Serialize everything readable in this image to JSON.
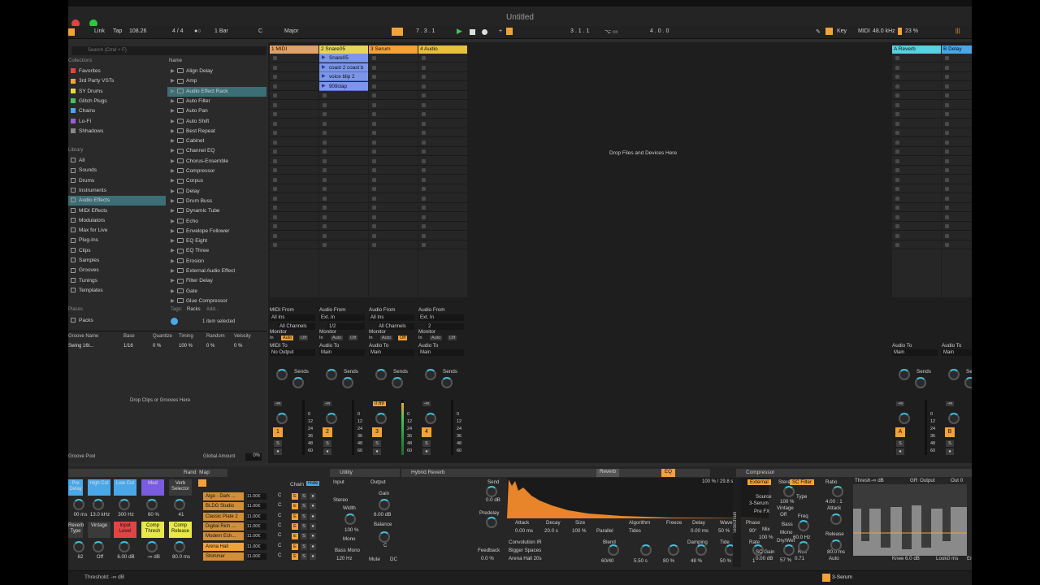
{
  "window": {
    "title": "Untitled"
  },
  "control_bar": {
    "link": "Link",
    "tap": "Tap",
    "tempo": "108.26",
    "signature": "4 / 4",
    "quant": "1 Bar",
    "key": "C",
    "scale": "Major",
    "position": "7 .  3 .  1",
    "loop_start": "3 .  1 .  1",
    "loop_len": "4 .  0 .  0",
    "key_map": "Key",
    "midi": "MIDI",
    "sample_rate": "48.0 kHz",
    "cpu": "23 %"
  },
  "browser": {
    "search_placeholder": "Search (Cmd + F)",
    "collections_header": "Collections",
    "collections": [
      {
        "label": "Favorites",
        "color": "#e04545"
      },
      {
        "label": "3rd Party VSTs",
        "color": "#f2a23a"
      },
      {
        "label": "SY Drums",
        "color": "#e8d83a"
      },
      {
        "label": "Glitch Plugs",
        "color": "#46c25a"
      },
      {
        "label": "Chains",
        "color": "#4aa7e8"
      },
      {
        "label": "Lo-FI",
        "color": "#9a5ce0"
      },
      {
        "label": "Shhadows",
        "color": "#888888"
      }
    ],
    "library_header": "Library",
    "library": [
      "All",
      "Sounds",
      "Drums",
      "Instruments",
      "Audio Effects",
      "MIDI Effects",
      "Modulators",
      "Max for Live",
      "Plug-Ins",
      "Clips",
      "Samples",
      "Grooves",
      "Tunings",
      "Templates"
    ],
    "places_header": "Places",
    "places": [
      "Packs"
    ],
    "name_header": "Name",
    "files": [
      "Align Delay",
      "Amp",
      "Audio Effect Rack",
      "Auto Filter",
      "Auto Pan",
      "Auto Shift",
      "Best Repeat",
      "Cabinet",
      "Channel EQ",
      "Chorus-Ensemble",
      "Compressor",
      "Corpus",
      "Delay",
      "Drum Buss",
      "Dynamic Tube",
      "Echo",
      "Envelope Follower",
      "EQ Eight",
      "EQ Three",
      "Erosion",
      "External Audio Effect",
      "Filter Delay",
      "Gate",
      "Glue Compressor"
    ],
    "tags_label": "Tags:",
    "tag_racks": "Racks",
    "tag_add": "Add...",
    "selected": "1 item selected"
  },
  "groove": {
    "headers": [
      "Groove Name",
      "Base",
      "Quantize",
      "Timing",
      "Random",
      "Velocity"
    ],
    "row": [
      "Swing 16t...",
      "1/16",
      "0 %",
      "100 %",
      "0 %",
      "0 %"
    ],
    "drop_text": "Drop Clips or Grooves Here",
    "pool": "Groove Pool",
    "global_label": "Global Amount",
    "global_value": "0%"
  },
  "session": {
    "tracks": [
      {
        "name": "1 MIDI",
        "color": "#e0a16a",
        "clips": [],
        "num": "1"
      },
      {
        "name": "2 Snare05",
        "color": "#e8d45a",
        "clips": [
          "Snare05",
          "coast 2 coast b",
          "voice blip 2",
          "909clap"
        ],
        "num": "2"
      },
      {
        "name": "3 Serum",
        "color": "#f2a23a",
        "clips": [],
        "num": "3"
      },
      {
        "name": "4 Audio",
        "color": "#e8c040",
        "clips": [],
        "num": "4"
      }
    ],
    "returns": [
      {
        "name": "A Reverb",
        "color": "#5ad0e0",
        "num": "A"
      },
      {
        "name": "B Delay",
        "color": "#4aa7e8",
        "num": "B"
      }
    ],
    "master": {
      "name": "Main",
      "color": "#e8e84a"
    },
    "drop_text": "Drop Files and Devices Here",
    "scene_numbers": [
      "1",
      "2",
      "3",
      "4",
      "5",
      "6",
      "7",
      "8",
      "9",
      "10",
      "11",
      "12",
      "13",
      "14",
      "15",
      "16",
      "17",
      "18",
      "19",
      "20",
      "21"
    ],
    "io": {
      "midi_from": "MIDI From",
      "all_ins": "All Ins",
      "all_channels": "All Channels",
      "monitor": "Monitor",
      "in": "In",
      "auto": "Auto",
      "off": "Off",
      "midi_to": "MIDI To",
      "no_output": "No Output",
      "audio_from": "Audio From",
      "ext_in": "Ext. In",
      "ch12": "1/2",
      "ch2": "2",
      "audio_to": "Audio To",
      "main": "Main",
      "sends": "Sends",
      "cue_out": "Cue Out",
      "main_out": "Main Out",
      "post": "Post",
      "solo": "Solo"
    },
    "serum_meter": "0.69",
    "neg_inf": "-∞",
    "db_scale": [
      "0",
      "12",
      "24",
      "36",
      "48",
      "60"
    ]
  },
  "devices": {
    "rand": "Rand",
    "map": "Map",
    "macros_top": [
      "Pre Delay",
      "High Cut",
      "Low Cut",
      "Mod",
      "Verb Selector"
    ],
    "macro_vals_top": [
      "00 ms",
      "13.0 kHz",
      "300 Hz",
      "60 %",
      "41"
    ],
    "macros_bottom": [
      "Reverb Type",
      "Vintage",
      "Input Level",
      "Comp Thresh",
      "Comp Release"
    ],
    "macro_vals_bottom": [
      "82",
      "Off",
      "6.00 dB",
      "-∞ dB",
      "80.0 ms"
    ],
    "chain_label": "Chain",
    "hide": "Hide",
    "chains": [
      "Algo - Dark ...",
      "BLDG Studio",
      "Classic Plate 2",
      "Digital Rich ...",
      "Modern Ech...",
      "Arena Hall",
      "Shimmer"
    ],
    "chain_vol": "11.00€",
    "utility": {
      "name": "Utility",
      "input": "Input",
      "output": "Output",
      "stereo": "Stereo",
      "width": "Width",
      "width_val": "100 %",
      "mono": "Mono",
      "bass_mono": "Bass Mono",
      "bass_freq": "120 Hz",
      "gain": "Gain",
      "gain_val": "6.00 dB",
      "balance": "Balance",
      "balance_val": "C",
      "mute": "Mute",
      "dc": "DC"
    },
    "reverb": {
      "name": "Hybrid Reverb",
      "tab1": "Reverb",
      "tab2": "EQ",
      "send": "Send",
      "send_val": "0.0 dB",
      "predelay": "Predelay",
      "feedback": "Feedback",
      "feedback_val": "0.0 %",
      "time": "100 % / 29.8 s",
      "attack": "Attack",
      "decay": "Decay",
      "size": "Size",
      "attack_val": "0.00 ms",
      "decay_val": "20.0 s",
      "size_val": "100 %",
      "algorithm": "Algorithm",
      "algo_val": "Tides",
      "freeze": "Freeze",
      "delay": "Delay",
      "delay_val": "0.00 ms",
      "wave": "Wave",
      "wave_val": "50 %",
      "phase": "Phase",
      "phase_val": "90°",
      "parallel": "Parallel",
      "conv_ir": "Convolution IR",
      "bigger": "Bigger Spaces",
      "arena": "Arena Hall 20s",
      "blend": "Blend",
      "blend_val": "60/40",
      "decay2_val": "5.50 s",
      "size2_val": "80 %",
      "damping": "Damping",
      "damping_val": "48 %",
      "tide": "Tide",
      "tide_val": "50 %",
      "rate": "Rate",
      "rate_val": "1",
      "stereo": "Stereo",
      "stereo_val": "100 %",
      "vintage": "Vintage",
      "vintage_val": "Off",
      "bass": "Bass",
      "bass_val": "Mono",
      "drywet": "Dry/Wet",
      "drywet_val": "57 %"
    },
    "compressor": {
      "name": "Compressor",
      "external": "External",
      "sc_filter": "SC Filter",
      "source": "Source",
      "source_val": "3-Serum",
      "pre_fx": "Pre FX",
      "mix": "Mix",
      "mix_val": "100 %",
      "sc_gain": "SC Gain",
      "sc_gain_val": "0.00 dB",
      "type": "Type",
      "freq": "Freq",
      "freq_val": "60.0 Hz",
      "res": "Res",
      "res_val": "0.71",
      "ratio": "Ratio",
      "ratio_val": "4.00 : 1",
      "attack": "Attack",
      "release": "Release",
      "release_val": "80.0 ms",
      "auto": "Auto",
      "thresh": "Thresh",
      "thresh_val": "-∞ dB",
      "gr": "GR",
      "output": "Output",
      "out_val": "Out 0",
      "knee": "Knee",
      "knee_val": "6.0 dB",
      "look": "Look.",
      "look_val": "0 ms",
      "env": "Env."
    },
    "sidechain": "Sidechain"
  },
  "status": {
    "text": "Threshold: -∞ dB",
    "track": "3-Serum"
  },
  "colors": {
    "accent": "#f2a23a",
    "teal": "#3c6e75",
    "meter_green": "#46c25a"
  }
}
